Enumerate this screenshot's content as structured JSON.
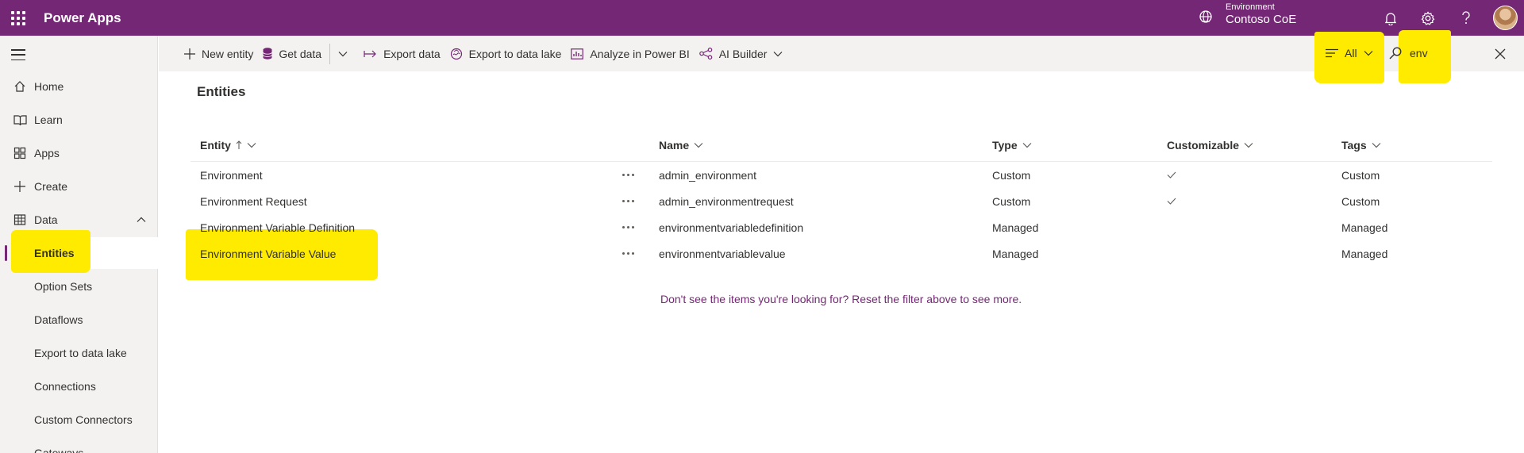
{
  "header": {
    "app_title": "Power Apps",
    "environment_label": "Environment",
    "environment_name": "Contoso CoE",
    "brand_color": "#742774"
  },
  "sidebar": {
    "items": [
      {
        "label": "Home",
        "icon": "home-icon"
      },
      {
        "label": "Learn",
        "icon": "book-icon"
      },
      {
        "label": "Apps",
        "icon": "apps-icon"
      },
      {
        "label": "Create",
        "icon": "plus-icon"
      },
      {
        "label": "Data",
        "icon": "table-icon",
        "expanded": true
      }
    ],
    "sub_items": [
      {
        "label": "Entities",
        "selected": true
      },
      {
        "label": "Option Sets"
      },
      {
        "label": "Dataflows"
      },
      {
        "label": "Export to data lake"
      },
      {
        "label": "Connections"
      },
      {
        "label": "Custom Connectors"
      },
      {
        "label": "Gateways"
      }
    ]
  },
  "commandbar": {
    "new_entity": "New entity",
    "get_data": "Get data",
    "export_data": "Export data",
    "export_to_data_lake": "Export to data lake",
    "analyze_power_bi": "Analyze in Power BI",
    "ai_builder": "AI Builder",
    "filter_value": "All",
    "search_value": "env"
  },
  "main": {
    "title": "Entities",
    "columns": [
      "Entity",
      "Name",
      "Type",
      "Customizable",
      "Tags"
    ],
    "rows": [
      {
        "entity": "Environment",
        "name": "admin_environment",
        "type": "Custom",
        "customizable": true,
        "tags": "Custom"
      },
      {
        "entity": "Environment Request",
        "name": "admin_environmentrequest",
        "type": "Custom",
        "customizable": true,
        "tags": "Custom"
      },
      {
        "entity": "Environment Variable Definition",
        "name": "environmentvariabledefinition",
        "type": "Managed",
        "customizable": false,
        "tags": "Managed"
      },
      {
        "entity": "Environment Variable Value",
        "name": "environmentvariablevalue",
        "type": "Managed",
        "customizable": false,
        "tags": "Managed"
      }
    ],
    "footer_note": "Don't see the items you're looking for? Reset the filter above to see more."
  },
  "colors": {
    "highlight": "#ffeb00",
    "sidebar_bg": "#f3f2f1",
    "link": "#742774"
  }
}
